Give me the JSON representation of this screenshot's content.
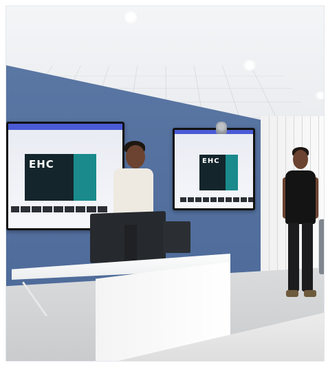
{
  "scene": {
    "left_screen_logo": "EHC",
    "right_screen_logo": "EHC"
  },
  "colors": {
    "wall": "#5a76a3",
    "slide_background": "#14262c",
    "slide_accent": "#1a8a8c",
    "browser_bar": "#4b5bd6"
  }
}
